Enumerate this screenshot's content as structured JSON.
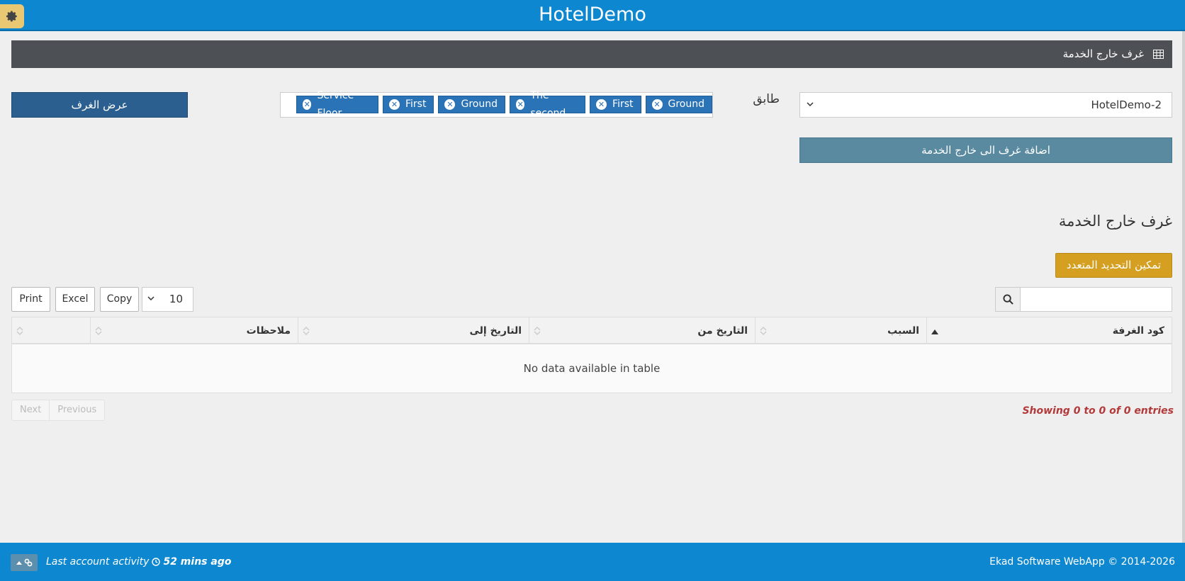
{
  "header": {
    "title": "HotelDemo"
  },
  "panel": {
    "title": "غرف خارج الخدمة"
  },
  "form": {
    "floor_label": "طابق",
    "hotel_value": "HotelDemo-2",
    "tags": [
      "Service Floor",
      "First",
      "Ground",
      "The second",
      "First",
      "Ground"
    ],
    "show_rooms_label": "عرض الغرف",
    "add_label": "اضافة غرف الى خارج الخدمة"
  },
  "section": {
    "title": "غرف خارج الخدمة",
    "multi_select_label": "تمكين التحديد المتعدد"
  },
  "toolbar": {
    "print_label": "Print",
    "excel_label": "Excel",
    "copy_label": "Copy",
    "page_length": "10"
  },
  "table": {
    "columns": [
      "كود الغرفة",
      "السبب",
      "التاريخ من",
      "التاريخ إلى",
      "ملاحظات",
      ""
    ],
    "empty_text": "No data available in table"
  },
  "pagination": {
    "next_label": "Next",
    "previous_label": "Previous",
    "info": "Showing 0 to 0 of 0 entries"
  },
  "footer": {
    "activity_label": "Last account activity",
    "activity_time": "52 mins ago",
    "copyright": "Ekad Software WebApp © 2014-2026"
  },
  "colors": {
    "topbar": "#0d87cf",
    "panel_head": "#4d5156",
    "primary_button": "#2a5f8f",
    "add_button": "#5a8aa0",
    "warning_button": "#d5a021",
    "tag": "#2b73b7",
    "info_text": "#b33a3a"
  }
}
